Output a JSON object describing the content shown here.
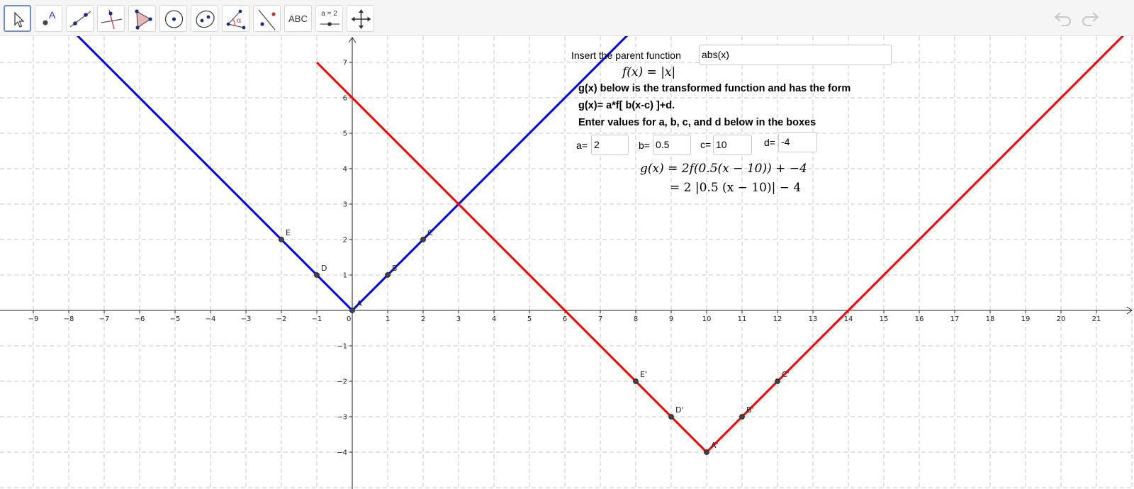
{
  "toolbar": {
    "tools": [
      {
        "name": "move-tool",
        "icon": "pointer-arrow-icon",
        "label": ""
      },
      {
        "name": "point-tool",
        "icon": "point-a-icon",
        "label": "A"
      },
      {
        "name": "line-tool",
        "icon": "line-through-points-icon",
        "label": ""
      },
      {
        "name": "perpendicular-tool",
        "icon": "perpendicular-line-icon",
        "label": ""
      },
      {
        "name": "polygon-tool",
        "icon": "polygon-icon",
        "label": ""
      },
      {
        "name": "circle-tool",
        "icon": "circle-center-point-icon",
        "label": ""
      },
      {
        "name": "ellipse-tool",
        "icon": "ellipse-icon",
        "label": ""
      },
      {
        "name": "angle-tool",
        "icon": "angle-icon",
        "label": "α"
      },
      {
        "name": "reflect-tool",
        "icon": "reflect-about-line-icon",
        "label": ""
      },
      {
        "name": "text-tool",
        "icon": "text-icon",
        "label": "ABC"
      },
      {
        "name": "slider-tool",
        "icon": "slider-icon",
        "label": "a = 2"
      },
      {
        "name": "move-graphics-tool",
        "icon": "move-graphics-view-icon",
        "label": ""
      }
    ],
    "undo_icon": "undo-icon",
    "redo_icon": "redo-icon"
  },
  "panel": {
    "parent_label": "Insert the parent function",
    "parent_value": "abs(x)",
    "f_display": "f(x) = |x|",
    "desc_line1": "g(x) below is the transformed function and has the form",
    "desc_line2": "g(x)= a*f[ b(x-c) ]+d.",
    "desc_line3": "Enter values for a, b, c, and d below in the boxes",
    "a_label": "a=",
    "a_value": "2",
    "b_label": "b=",
    "b_value": "0.5",
    "c_label": "c=",
    "c_value": "10",
    "d_label": "d=",
    "d_value": "-4",
    "g_line1": "g(x) = 2f(0.5(x − 10)) + −4",
    "g_line2": "= 2 |0.5 (x − 10)| − 4"
  },
  "chart_data": {
    "type": "line",
    "xlim": [
      -9.9,
      22.2
    ],
    "ylim": [
      -5,
      7.8
    ],
    "grid": true,
    "x_ticks": [
      -9,
      -8,
      -7,
      -6,
      -5,
      -4,
      -3,
      -2,
      -1,
      1,
      2,
      3,
      4,
      5,
      6,
      7,
      8,
      9,
      10,
      11,
      12,
      13,
      14,
      15,
      16,
      17,
      18,
      19,
      20,
      21
    ],
    "y_ticks": [
      -4,
      -3,
      -2,
      -1,
      1,
      2,
      3,
      4,
      5,
      6,
      7
    ],
    "origin_label": "0",
    "series": [
      {
        "expr": "abs(x)",
        "color": "#0000ff",
        "values": [
          [
            -8,
            8
          ],
          [
            0,
            0
          ],
          [
            8,
            8
          ]
        ]
      },
      {
        "expr": "2|0.5(x-10)|-4",
        "color": "#ff0000",
        "values": [
          [
            -1,
            7
          ],
          [
            10,
            -4
          ],
          [
            22,
            8
          ]
        ]
      }
    ],
    "points": [
      {
        "label": "A",
        "x": 0,
        "y": 0
      },
      {
        "label": "B",
        "x": 1,
        "y": 1
      },
      {
        "label": "C",
        "x": 2,
        "y": 2
      },
      {
        "label": "D",
        "x": -1,
        "y": 1
      },
      {
        "label": "E",
        "x": -2,
        "y": 2
      },
      {
        "label": "A'",
        "x": 10,
        "y": -4
      },
      {
        "label": "B'",
        "x": 11,
        "y": -3
      },
      {
        "label": "C'",
        "x": 12,
        "y": -2
      },
      {
        "label": "D'",
        "x": 9,
        "y": -3
      },
      {
        "label": "E'",
        "x": 8,
        "y": -2
      }
    ]
  }
}
